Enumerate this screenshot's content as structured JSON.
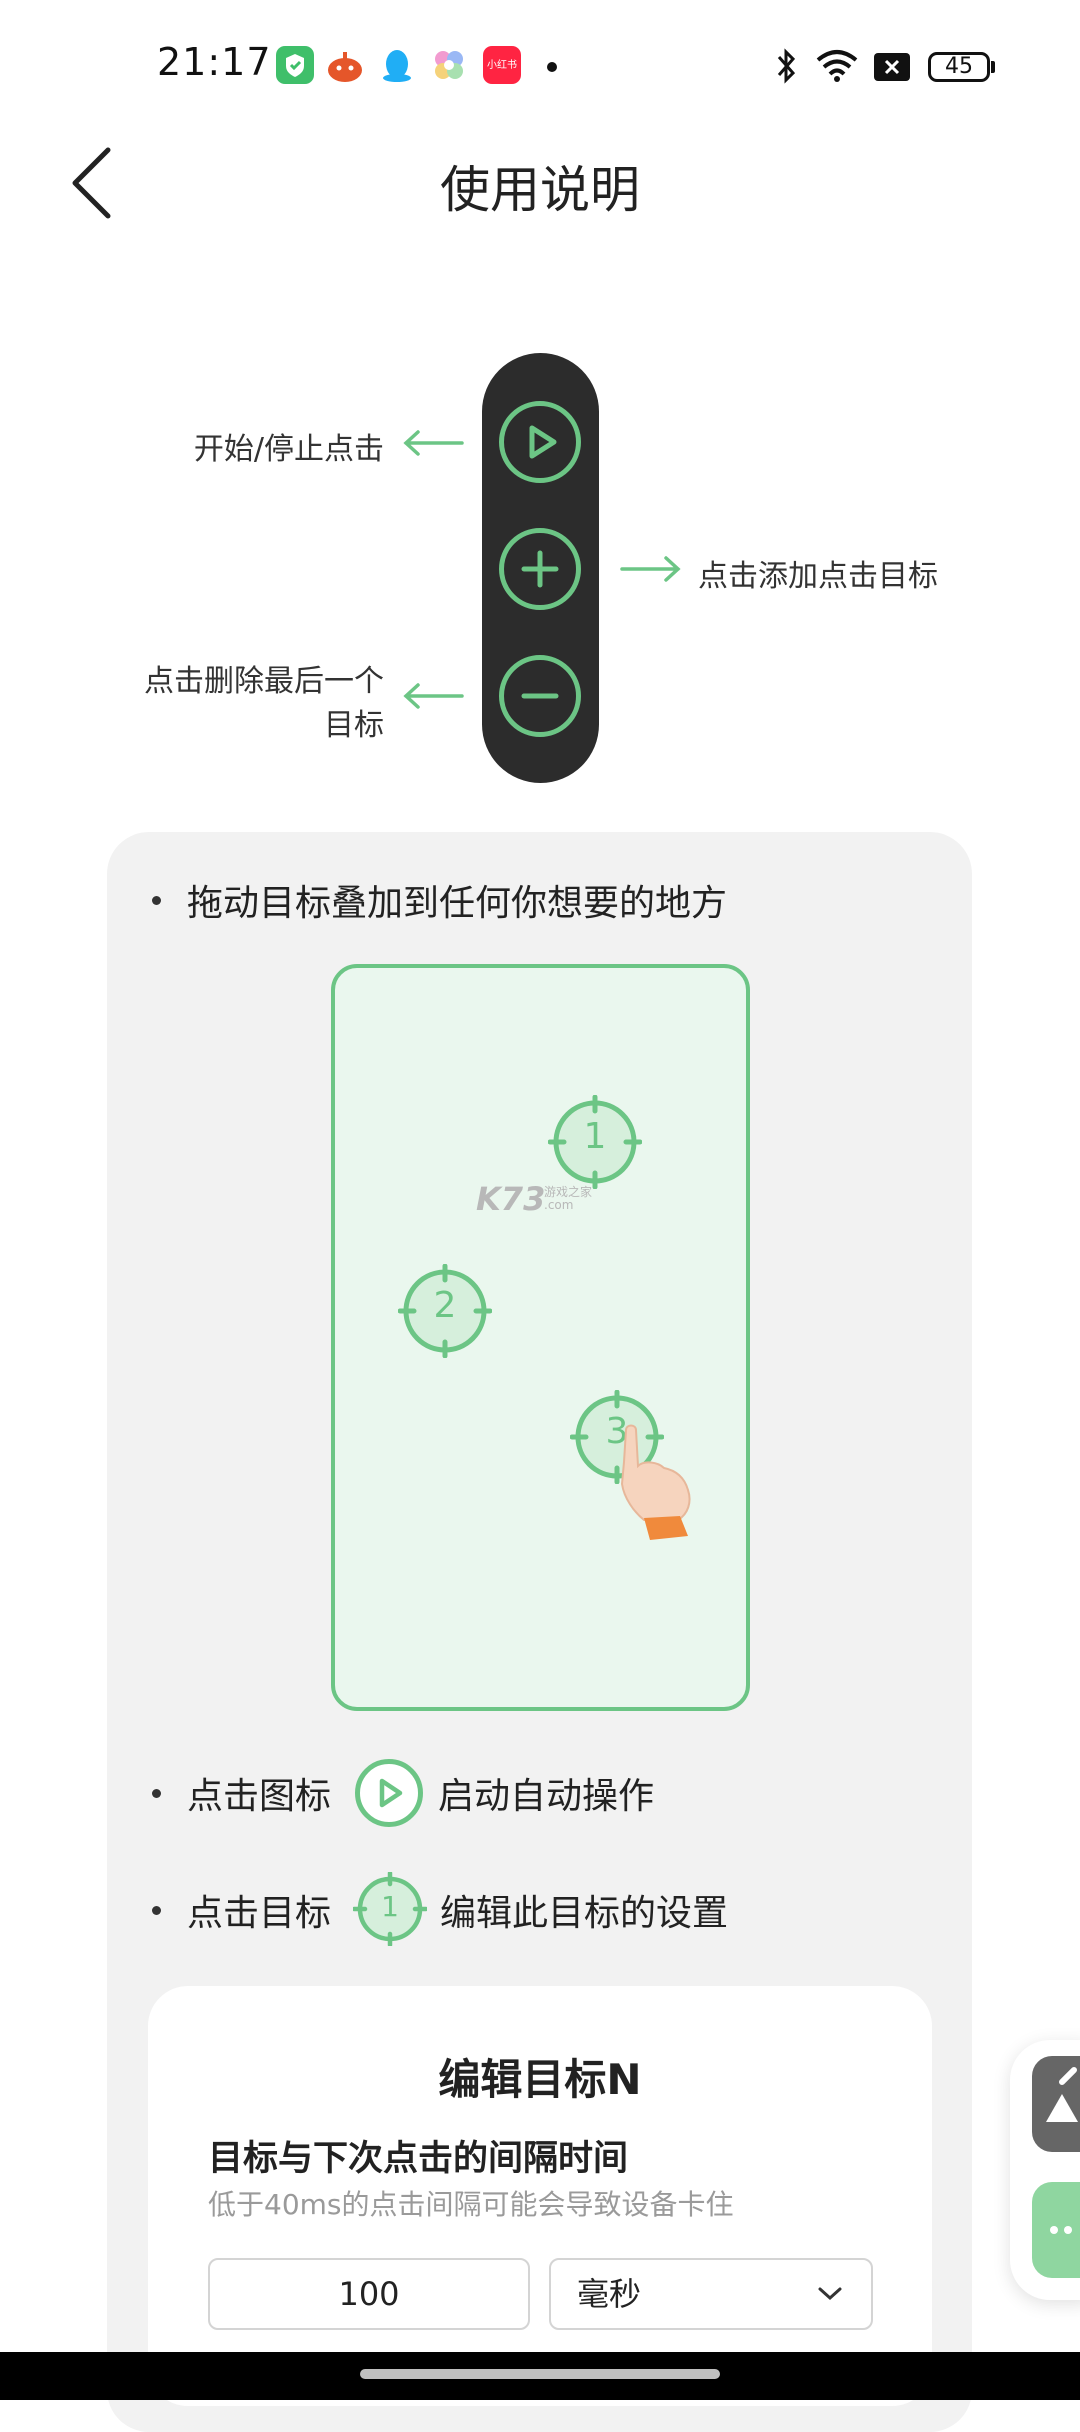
{
  "status_bar": {
    "time": "21:17",
    "app_icons": [
      {
        "name": "shield-app-icon",
        "color": "#3fbf6a"
      },
      {
        "name": "taobao-app-icon",
        "color": "#e5562a"
      },
      {
        "name": "qq-app-icon",
        "color": "#20aef5"
      },
      {
        "name": "flower-app-icon",
        "color": "#e8a8e6"
      },
      {
        "name": "xiaohongshu-app-icon",
        "color": "#ff2442"
      }
    ],
    "xiaohongshu_text": "小红书",
    "battery": "45"
  },
  "header": {
    "title": "使用说明"
  },
  "toolbar_diagram": {
    "annotation_play": "开始/停止点击",
    "annotation_add": "点击添加点击目标",
    "annotation_remove_line1": "点击删除最后一个",
    "annotation_remove_line2": "目标",
    "accent_color": "#6cc585"
  },
  "instructions": {
    "drag_text": "拖动目标叠加到任何你想要的地方",
    "targets": [
      "1",
      "2",
      "3"
    ],
    "watermark": "K73",
    "watermark_sub": "游戏之家",
    "watermark_sub2": ".com",
    "tap_icon_prefix": "点击图标",
    "tap_icon_suffix": "启动自动操作",
    "tap_target_prefix": "点击目标",
    "tap_target_badge": "1",
    "tap_target_suffix": "编辑此目标的设置"
  },
  "edit_card": {
    "title": "编辑目标N",
    "interval_label": "目标与下次点击的间隔时间",
    "interval_hint": "低于40ms的点击间隔可能会导致设备卡住",
    "interval_value": "100",
    "unit_selected": "毫秒"
  }
}
